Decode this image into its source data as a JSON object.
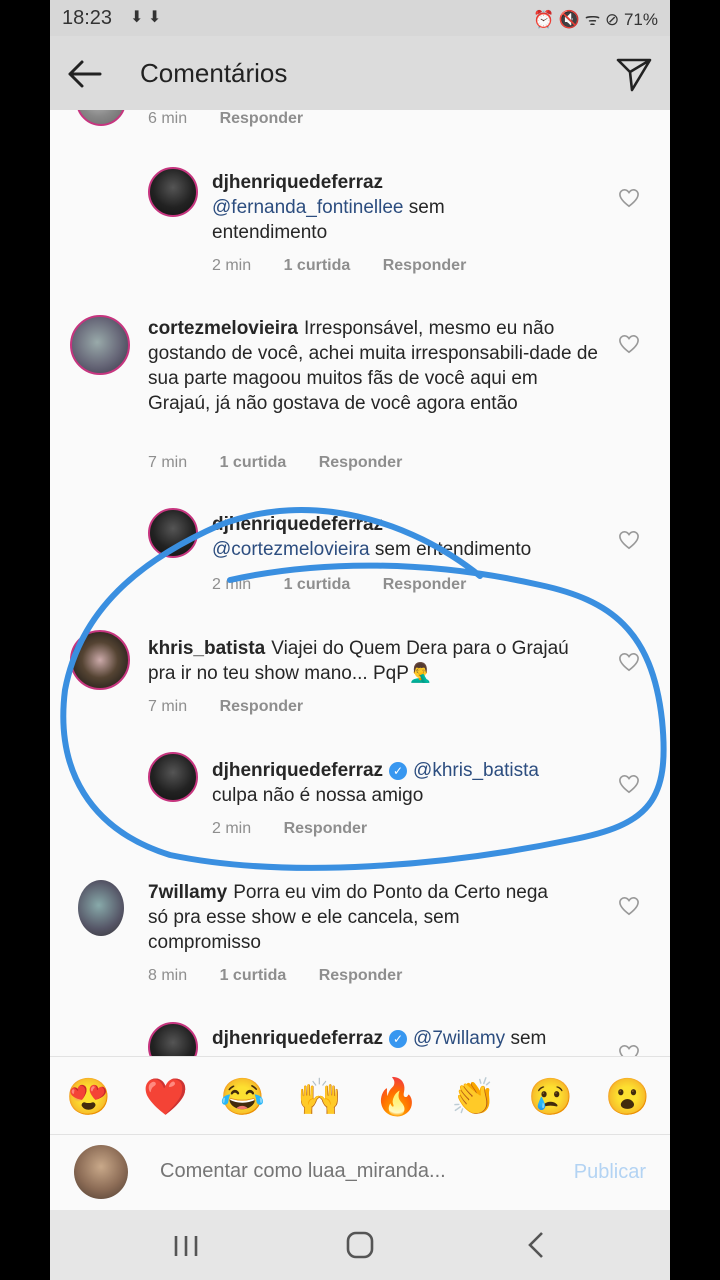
{
  "status": {
    "time": "18:23",
    "left_icons": "⬇ ⬇",
    "right_icons": "⏰ 🔇 ᯤ ⊘",
    "battery": "71%"
  },
  "header": {
    "title": "Comentários",
    "back_icon": "arrow-left-icon",
    "send_icon": "paper-plane-icon"
  },
  "comments": [
    {
      "time": "6 min",
      "reply": "Responder"
    },
    {
      "user": "djhenriquedeferraz",
      "mention": "@fernanda_fontinellee",
      "text": " sem entendimento",
      "time": "2 min",
      "likes": "1 curtida",
      "reply": "Responder"
    },
    {
      "user": "cortezmelovieira",
      "text": "Irresponsável, mesmo eu não gostando de você, achei muita irresponsabili-dade de sua parte magoou muitos fãs de você aqui em Grajaú, já não gostava de você agora então",
      "time": "7 min",
      "likes": "1 curtida",
      "reply": "Responder"
    },
    {
      "user": "djhenriquedeferraz",
      "mention": "@cortezmelovieira",
      "text": " sem entendimento",
      "time": "2 min",
      "likes": "1 curtida",
      "reply": "Responder"
    },
    {
      "user": "khris_batista",
      "text": "Viajei do Quem Dera para o Grajaú pra ir no teu show mano... PqP🤦‍♂️",
      "time": "7 min",
      "reply": "Responder"
    },
    {
      "user": "djhenriquedeferraz",
      "mention": "@khris_batista",
      "text": "culpa não é nossa amigo",
      "time": "2 min",
      "reply": "Responder"
    },
    {
      "user": "7willamy",
      "text": "Porra eu vim do Ponto da Certo nega só pra esse show e ele cancela, sem compromisso",
      "time": "8 min",
      "likes": "1 curtida",
      "reply": "Responder"
    },
    {
      "user": "djhenriquedeferraz",
      "mention": "@7willamy",
      "text": " sem"
    }
  ],
  "emojis": [
    "😍",
    "❤️",
    "😂",
    "🙌",
    "🔥",
    "👏",
    "😢",
    "😮"
  ],
  "input": {
    "placeholder": "Comentar como luaa_miranda...",
    "publish": "Publicar"
  },
  "colors": {
    "annotation": "#3a8fe0",
    "mention": "#2c4d7f",
    "story_ring": "#c6357f"
  }
}
